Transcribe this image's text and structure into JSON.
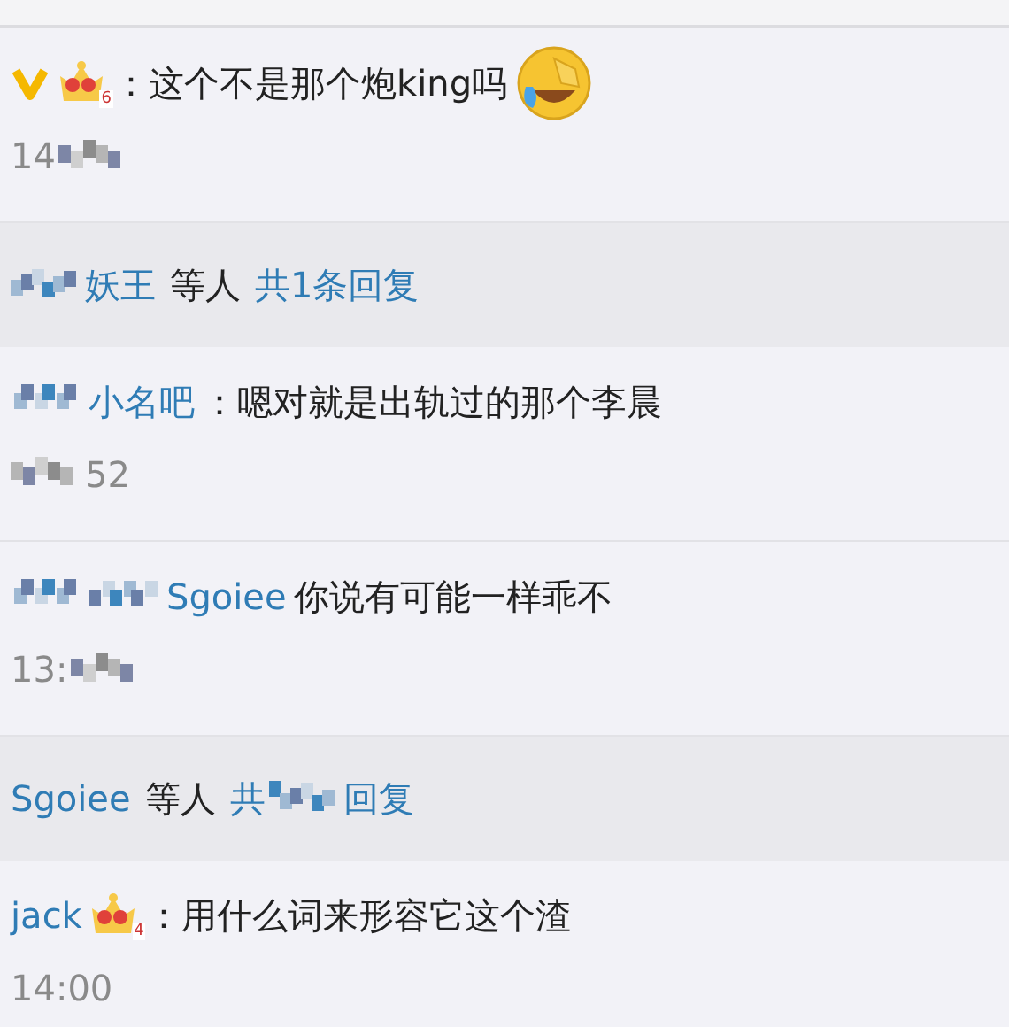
{
  "items": [
    {
      "kind": "comment",
      "line": [
        {
          "kind": "vip"
        },
        {
          "kind": "crown",
          "text": "6"
        },
        {
          "kind": "text",
          "text": "：这个不是那个炮king吗"
        },
        {
          "kind": "emoji"
        }
      ],
      "time": [
        {
          "kind": "text",
          "text": "14"
        },
        {
          "kind": "redacted"
        }
      ]
    },
    {
      "kind": "replies",
      "line": [
        {
          "kind": "redacted"
        },
        {
          "kind": "name",
          "text": "妖王"
        },
        {
          "kind": "text",
          "text": "等人"
        },
        {
          "kind": "link",
          "text": "共1条回复"
        }
      ]
    },
    {
      "kind": "comment",
      "line": [
        {
          "kind": "redacted"
        },
        {
          "kind": "name",
          "text": "小名吧"
        },
        {
          "kind": "text",
          "text": "：嗯对就是出轨过的那个李晨"
        }
      ],
      "time": [
        {
          "kind": "redacted"
        },
        {
          "kind": "text",
          "text": "52"
        }
      ]
    },
    {
      "kind": "comment",
      "line": [
        {
          "kind": "redacted"
        },
        {
          "kind": "redacted"
        },
        {
          "kind": "name",
          "text": "Sgoiee"
        },
        {
          "kind": "text",
          "text": "你说有可能一样乖不"
        }
      ],
      "time": [
        {
          "kind": "text",
          "text": "13:"
        },
        {
          "kind": "redacted"
        }
      ]
    },
    {
      "kind": "replies",
      "line": [
        {
          "kind": "name",
          "text": "Sgoiee"
        },
        {
          "kind": "text",
          "text": "等人"
        },
        {
          "kind": "link",
          "text": "共"
        },
        {
          "kind": "redacted"
        },
        {
          "kind": "link",
          "text": "回复"
        }
      ]
    },
    {
      "kind": "comment",
      "line": [
        {
          "kind": "name",
          "text": "jack"
        },
        {
          "kind": "crown",
          "text": "4"
        },
        {
          "kind": "text",
          "text": "：用什么词来形容它这个渣"
        }
      ],
      "time": [
        {
          "kind": "text",
          "text": "14:00"
        }
      ]
    }
  ]
}
